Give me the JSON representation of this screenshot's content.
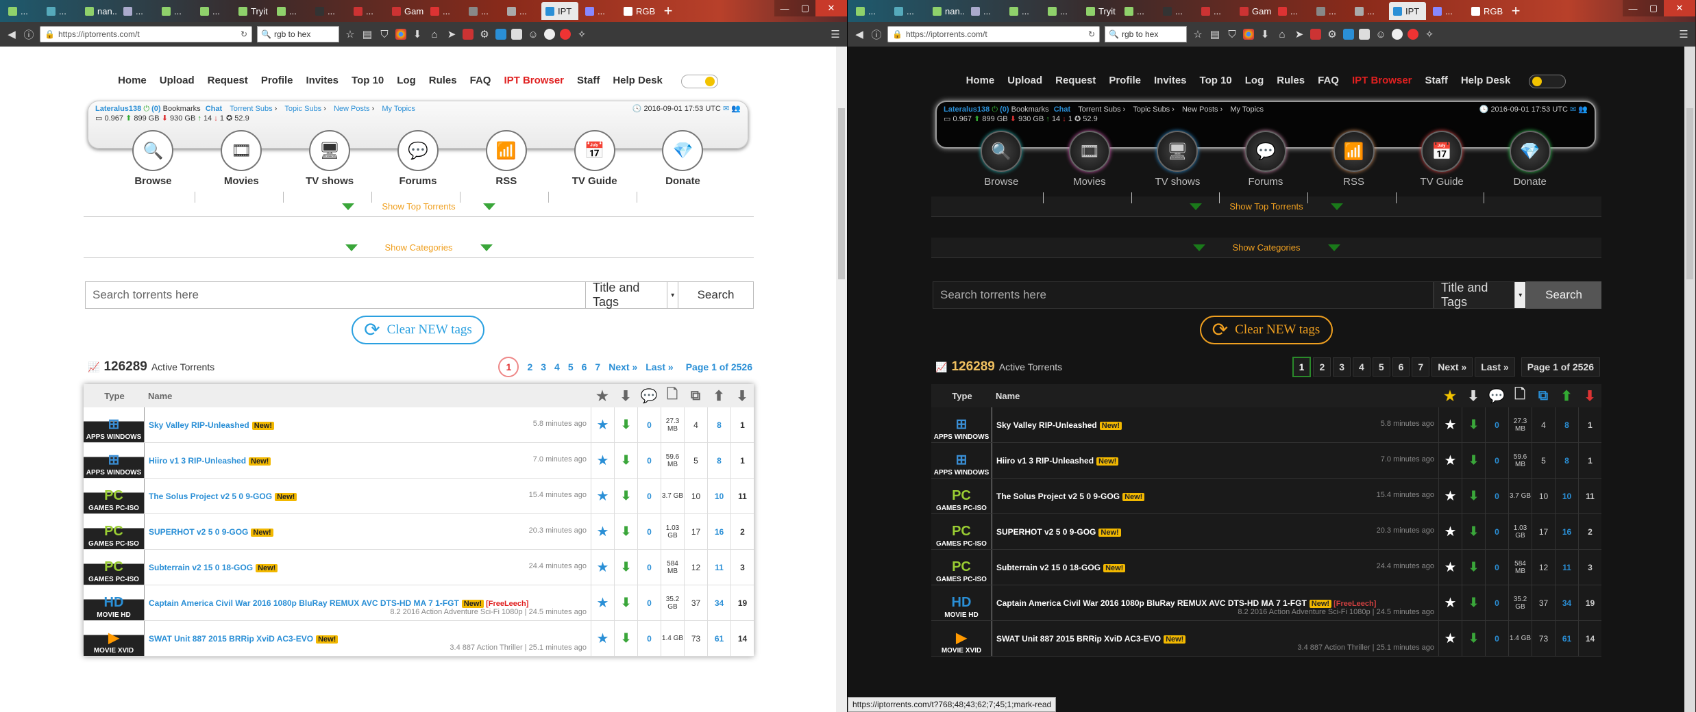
{
  "tabs": [
    {
      "label": "..."
    },
    {
      "label": "..."
    },
    {
      "label": "nan..."
    },
    {
      "label": "..."
    },
    {
      "label": "..."
    },
    {
      "label": "..."
    },
    {
      "label": "Tryit ..."
    },
    {
      "label": "..."
    },
    {
      "label": "..."
    },
    {
      "label": "..."
    },
    {
      "label": "Gam..."
    },
    {
      "label": "..."
    },
    {
      "label": "..."
    },
    {
      "label": "..."
    },
    {
      "label": "IPT"
    },
    {
      "label": "..."
    },
    {
      "label": "RGB..."
    }
  ],
  "new_tab": "+",
  "url": "https://iptorrents.com/t",
  "search_engine": "rgb to hex",
  "menu": [
    "Home",
    "Upload",
    "Request",
    "Profile",
    "Invites",
    "Top 10",
    "Log",
    "Rules",
    "FAQ",
    "IPT Browser",
    "Staff",
    "Help Desk"
  ],
  "user": {
    "name": "Lateralus138",
    "bookmarks_count": "(0)",
    "bookmarks": "Bookmarks",
    "chat": "Chat",
    "links": [
      "Torrent Subs",
      "Topic Subs",
      "New Posts",
      "My Topics"
    ],
    "ratio": "0.967",
    "uploaded": "899 GB",
    "downloaded": "930 GB",
    "seeding": "14",
    "leeching": "1",
    "bonus": "52.9",
    "datetime": "2016-09-01 17:53 UTC"
  },
  "categories": [
    {
      "label": "Browse",
      "icon": "search-icon",
      "glyph": "🔍"
    },
    {
      "label": "Movies",
      "icon": "film-icon",
      "glyph": "🎞"
    },
    {
      "label": "TV shows",
      "icon": "tv-icon",
      "glyph": "🖥"
    },
    {
      "label": "Forums",
      "icon": "chat-bubble-icon",
      "glyph": "💬"
    },
    {
      "label": "RSS",
      "icon": "rss-icon",
      "glyph": "📶"
    },
    {
      "label": "TV Guide",
      "icon": "calendar-icon",
      "glyph": "📅"
    },
    {
      "label": "Donate",
      "icon": "diamond-icon",
      "glyph": "💎"
    }
  ],
  "show_top": "Show Top Torrents",
  "show_cats": "Show Categories",
  "search": {
    "placeholder": "Search torrents here",
    "mode": "Title and Tags",
    "button": "Search"
  },
  "clear_tags": "Clear NEW tags",
  "active_count": "126289",
  "active_label": "Active Torrents",
  "pager": {
    "pages": [
      "1",
      "2",
      "3",
      "4",
      "5",
      "6",
      "7"
    ],
    "next": "Next »",
    "last": "Last »",
    "info": "Page 1 of 2526"
  },
  "table_head": {
    "type": "Type",
    "name": "Name"
  },
  "new_badge": "New!",
  "rows": [
    {
      "cat": "APPS WINDOWS",
      "logo": "⊞",
      "name": "Sky Valley RIP-Unleashed",
      "time": "5.8 minutes ago",
      "tags": "",
      "free": "",
      "comments": "0",
      "size": "27.3 MB",
      "files": "4",
      "seeders": "8",
      "leechers": "1"
    },
    {
      "cat": "APPS WINDOWS",
      "logo": "⊞",
      "name": "Hiiro v1 3 RIP-Unleashed",
      "time": "7.0 minutes ago",
      "tags": "",
      "free": "",
      "comments": "0",
      "size": "59.6 MB",
      "files": "5",
      "seeders": "8",
      "leechers": "1"
    },
    {
      "cat": "GAMES PC-ISO",
      "logo": "PC",
      "name": "The Solus Project v2 5 0 9-GOG",
      "time": "15.4 minutes ago",
      "tags": "",
      "free": "",
      "comments": "0",
      "size": "3.7 GB",
      "files": "10",
      "seeders": "10",
      "leechers": "11"
    },
    {
      "cat": "GAMES PC-ISO",
      "logo": "PC",
      "name": "SUPERHOT v2 5 0 9-GOG",
      "time": "20.3 minutes ago",
      "tags": "",
      "free": "",
      "comments": "0",
      "size": "1.03 GB",
      "files": "17",
      "seeders": "16",
      "leechers": "2"
    },
    {
      "cat": "GAMES PC-ISO",
      "logo": "PC",
      "name": "Subterrain v2 15 0 18-GOG",
      "time": "24.4 minutes ago",
      "tags": "",
      "free": "",
      "comments": "0",
      "size": "584 MB",
      "files": "12",
      "seeders": "11",
      "leechers": "3"
    },
    {
      "cat": "MOVIE HD",
      "logo": "HD",
      "name": "Captain America Civil War 2016 1080p BluRay REMUX AVC DTS-HD MA 7 1-FGT",
      "time": "24.5 minutes ago",
      "tags": "8.2 2016 Action Adventure Sci-Fi 1080p",
      "free": "[FreeLeech]",
      "comments": "0",
      "size": "35.2 GB",
      "files": "37",
      "seeders": "34",
      "leechers": "19"
    },
    {
      "cat": "MOVIE XVID",
      "logo": "▶",
      "name": "SWAT Unit 887 2015 BRRip XviD AC3-EVO",
      "time": "25.1 minutes ago",
      "tags": "3.4 887 Action Thriller",
      "free": "",
      "comments": "0",
      "size": "1.4 GB",
      "files": "73",
      "seeders": "61",
      "leechers": "14"
    }
  ],
  "status_url": "https://iptorrents.com/t?768;48;43;62;7;45;1;mark-read"
}
